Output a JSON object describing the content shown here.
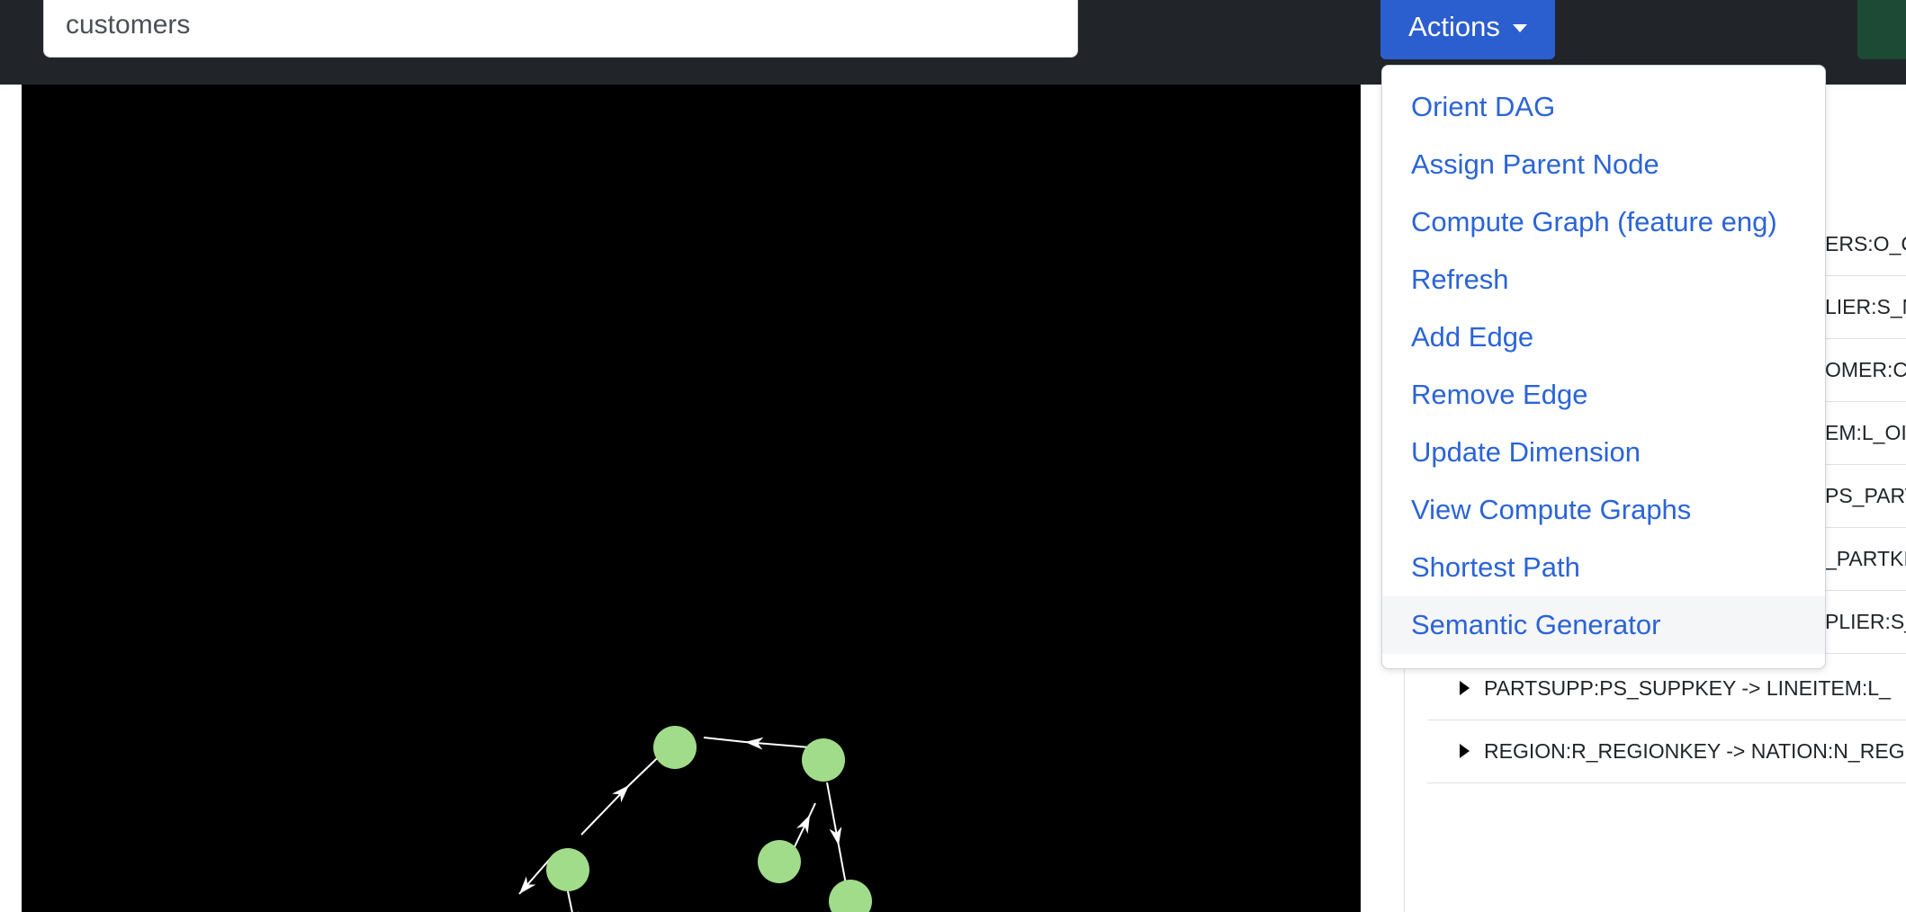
{
  "search": {
    "value": "customers"
  },
  "actions_button": {
    "label": "Actions"
  },
  "actions_menu": [
    "Orient DAG",
    "Assign Parent Node",
    "Compute Graph (feature eng)",
    "Refresh",
    "Add Edge",
    "Remove Edge",
    "Update Dimension",
    "View Compute Graphs",
    "Shortest Path",
    "Semantic Generator"
  ],
  "edges_partial": [
    "ERS:O_C",
    "LIER:S_N",
    "OMER:C_",
    "EM:L_OI",
    "PS_PART",
    "_PARTKI",
    "PLIER:S_"
  ],
  "edges_visible": [
    "PARTSUPP:PS_SUPPKEY -> LINEITEM:L_",
    "REGION:R_REGIONKEY -> NATION:N_REG"
  ],
  "graph": {
    "node_color": "#a0dc8a",
    "edge_color": "#ffffff"
  }
}
